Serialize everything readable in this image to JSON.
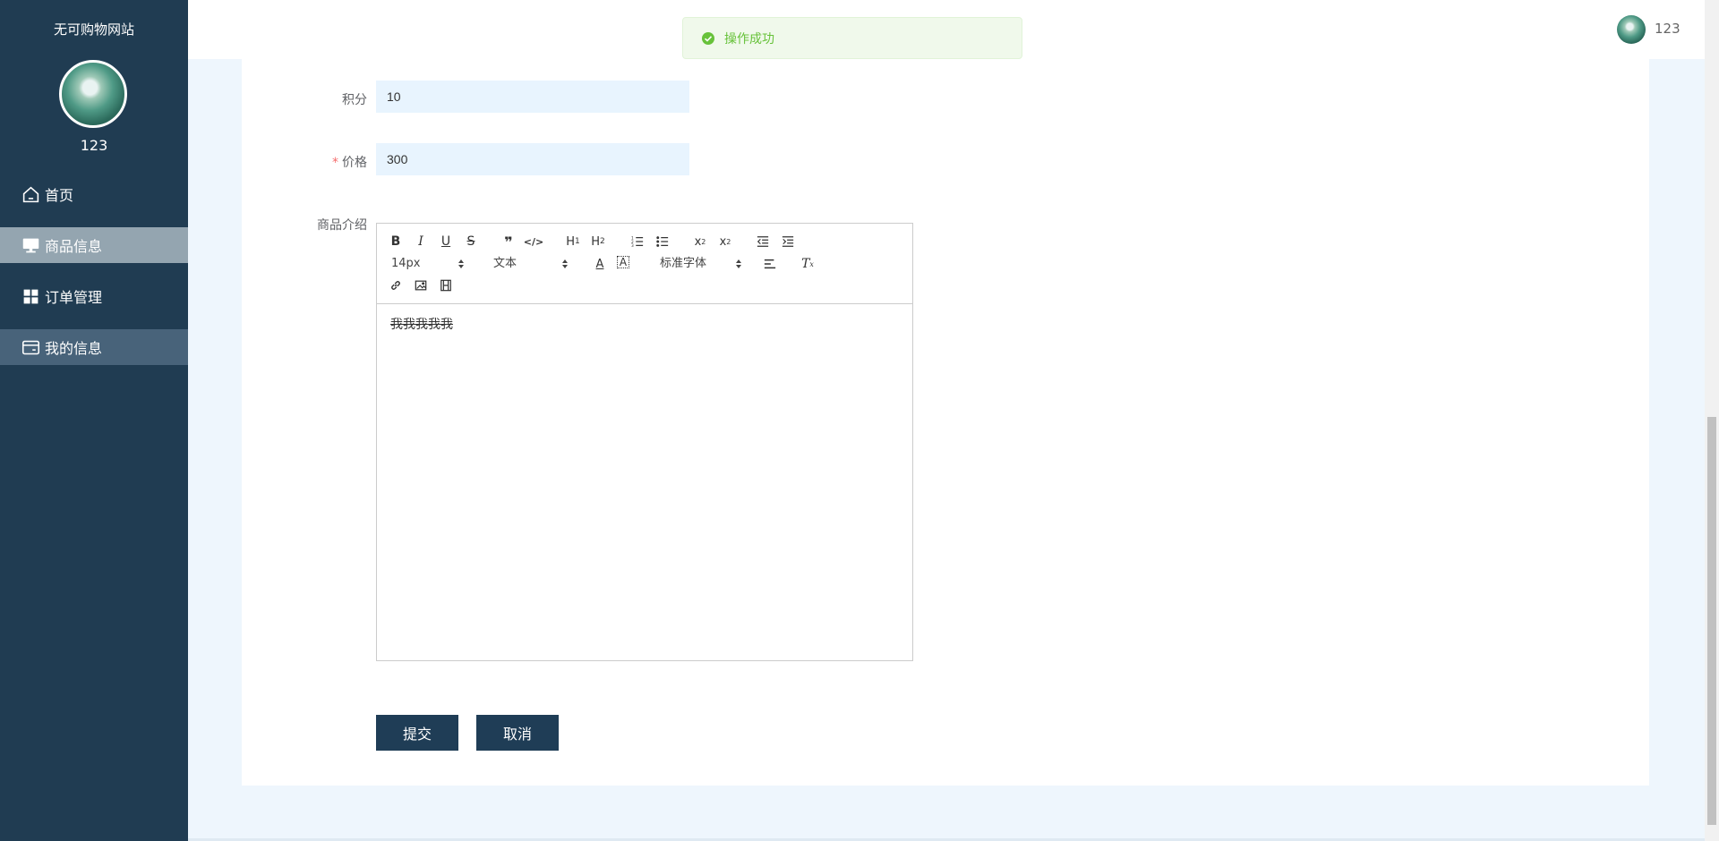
{
  "sidebar": {
    "title": "无可购物网站",
    "username": "123",
    "items": [
      {
        "label": "首页",
        "icon": "home-icon"
      },
      {
        "label": "商品信息",
        "icon": "monitor-icon"
      },
      {
        "label": "订单管理",
        "icon": "grid-icon"
      },
      {
        "label": "我的信息",
        "icon": "card-icon"
      }
    ]
  },
  "header": {
    "username": "123"
  },
  "toast": {
    "message": "操作成功",
    "color": "#67c23a"
  },
  "form": {
    "points": {
      "label": "积分",
      "value": "10"
    },
    "price": {
      "label": "价格",
      "required_mark": "*",
      "value": "300"
    },
    "description": {
      "label": "商品介绍",
      "toolbar": {
        "size_picker": "14px",
        "header_picker": "文本",
        "font_picker": "标准字体"
      },
      "content": "我我我我我"
    },
    "submit_label": "提交",
    "cancel_label": "取消"
  },
  "colors": {
    "sidebar_bg": "#203c52",
    "accent": "#1f3d56",
    "input_bg": "#e8f4fe",
    "page_bg": "#eef6fd"
  }
}
